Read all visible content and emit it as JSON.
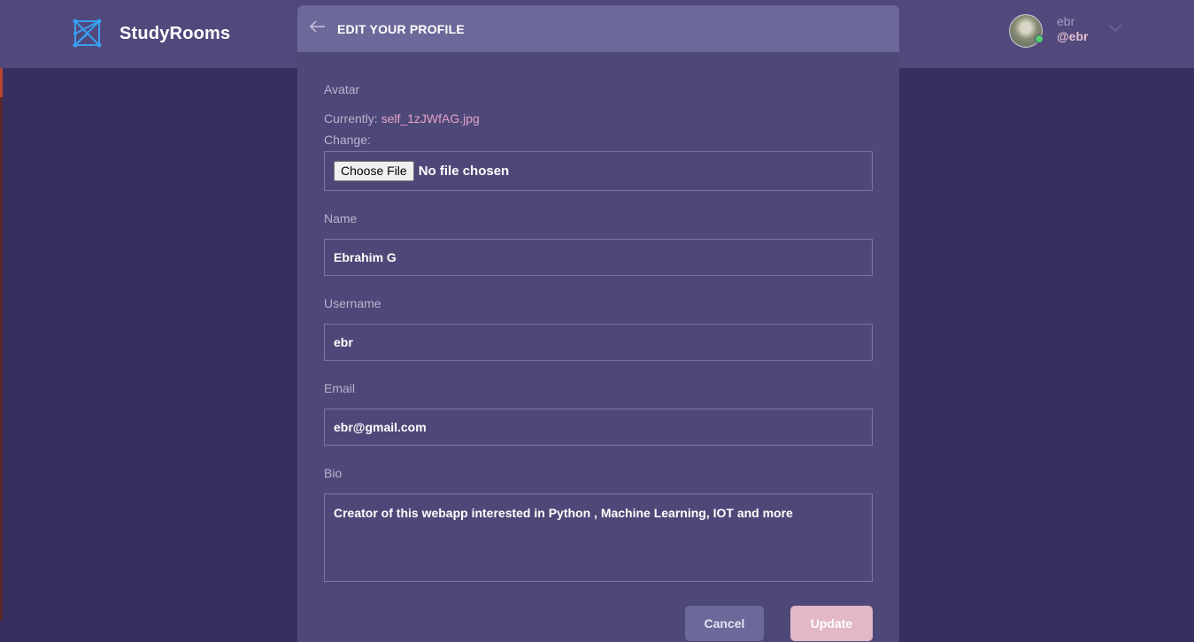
{
  "app": {
    "name": "StudyRooms"
  },
  "user": {
    "name": "ebr",
    "handle": "@ebr"
  },
  "form": {
    "title": "EDIT YOUR PROFILE",
    "avatar": {
      "label": "Avatar",
      "currently_label": "Currently:",
      "current_file": "self_1zJWfAG.jpg",
      "change_label": "Change:",
      "choose_button": "Choose File",
      "no_file": "No file chosen"
    },
    "name": {
      "label": "Name",
      "value": "Ebrahim G"
    },
    "username": {
      "label": "Username",
      "value": "ebr"
    },
    "email": {
      "label": "Email",
      "value": "ebr@gmail.com"
    },
    "bio": {
      "label": "Bio",
      "value": "Creator of this webapp interested in Python , Machine Learning, IOT and more"
    },
    "cancel_button": "Cancel",
    "update_button": "Update"
  },
  "colors": {
    "background": "#362f5f",
    "header": "#51497c",
    "card": "#4e4878",
    "card_header": "#6c6899",
    "accent_link": "#e2a3c8",
    "logo_blue": "#3a9ff0",
    "online": "#4ed06f"
  },
  "icons": [
    "logo-icon",
    "back-arrow-icon",
    "chevron-down-icon"
  ]
}
